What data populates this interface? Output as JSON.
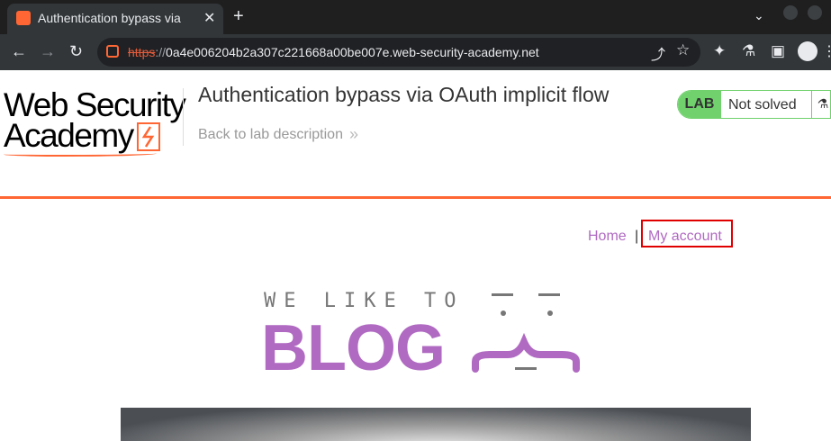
{
  "browser": {
    "tab_title": "Authentication bypass via",
    "tab_close": "✕",
    "new_tab": "+",
    "url_scheme": "https",
    "url_sep": "://",
    "url_host": "0a4e006204b2a307c221668a00be007e.web-security-academy.net",
    "icons": [
      "back-arrow-icon",
      "forward-arrow-icon",
      "reload-icon",
      "share-icon",
      "star-icon",
      "extensions-icon",
      "labs-flask-icon",
      "sidebar-icon",
      "profile-icon",
      "menu-kebab-icon"
    ]
  },
  "lab": {
    "logo_line1": "Web Security",
    "logo_line2": "Academy",
    "title": "Authentication bypass via OAuth implicit flow",
    "back_link": "Back to lab description",
    "status_badge": "LAB",
    "status_text": "Not solved",
    "accent_color": "#ff6633",
    "status_color": "#70d16d"
  },
  "blog": {
    "nav_home": "Home",
    "nav_separator": "|",
    "nav_account": "My account",
    "logo_small": "WE LIKE TO",
    "logo_big": "BLOG",
    "link_color": "#b06ac2"
  }
}
